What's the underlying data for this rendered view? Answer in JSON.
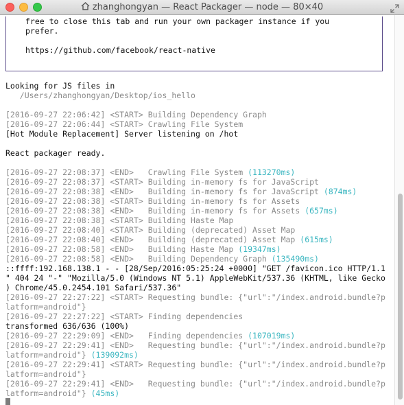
{
  "window": {
    "title": "zhanghongyan — React Packager — node — 80×40"
  },
  "banner": [
    "free to close this tab and run your own packager instance if you",
    "prefer.",
    "",
    "https://github.com/facebook/react-native",
    ""
  ],
  "lines": [
    {
      "segments": [
        {
          "text": "",
          "style": "normal"
        }
      ]
    },
    {
      "segments": [
        {
          "text": "Looking for JS files in",
          "style": "normal"
        }
      ]
    },
    {
      "segments": [
        {
          "text": "   /Users/zhanghongyan/Desktop/ios_hello",
          "style": "dim"
        }
      ]
    },
    {
      "segments": [
        {
          "text": "",
          "style": "normal"
        }
      ]
    },
    {
      "segments": [
        {
          "text": "[2016-09-27 22:06:42] <START> Building Dependency Graph",
          "style": "dim"
        }
      ]
    },
    {
      "segments": [
        {
          "text": "[2016-09-27 22:06:44] <START> Crawling File System",
          "style": "dim"
        }
      ]
    },
    {
      "segments": [
        {
          "text": "[Hot Module Replacement] Server listening on /hot",
          "style": "normal"
        }
      ]
    },
    {
      "segments": [
        {
          "text": "",
          "style": "normal"
        }
      ]
    },
    {
      "segments": [
        {
          "text": "React packager ready.",
          "style": "normal"
        }
      ]
    },
    {
      "segments": [
        {
          "text": "",
          "style": "normal"
        }
      ]
    },
    {
      "segments": [
        {
          "text": "[2016-09-27 22:08:37] <END>   Crawling File System ",
          "style": "dim"
        },
        {
          "text": "(113270ms)",
          "style": "time"
        }
      ]
    },
    {
      "segments": [
        {
          "text": "[2016-09-27 22:08:37] <START> Building in-memory fs for JavaScript",
          "style": "dim"
        }
      ]
    },
    {
      "segments": [
        {
          "text": "[2016-09-27 22:08:38] <END>   Building in-memory fs for JavaScript ",
          "style": "dim"
        },
        {
          "text": "(874ms)",
          "style": "time"
        }
      ]
    },
    {
      "segments": [
        {
          "text": "[2016-09-27 22:08:38] <START> Building in-memory fs for Assets",
          "style": "dim"
        }
      ]
    },
    {
      "segments": [
        {
          "text": "[2016-09-27 22:08:38] <END>   Building in-memory fs for Assets ",
          "style": "dim"
        },
        {
          "text": "(657ms)",
          "style": "time"
        }
      ]
    },
    {
      "segments": [
        {
          "text": "[2016-09-27 22:08:38] <START> Building Haste Map",
          "style": "dim"
        }
      ]
    },
    {
      "segments": [
        {
          "text": "[2016-09-27 22:08:40] <START> Building (deprecated) Asset Map",
          "style": "dim"
        }
      ]
    },
    {
      "segments": [
        {
          "text": "[2016-09-27 22:08:40] <END>   Building (deprecated) Asset Map ",
          "style": "dim"
        },
        {
          "text": "(615ms)",
          "style": "time"
        }
      ]
    },
    {
      "segments": [
        {
          "text": "[2016-09-27 22:08:58] <END>   Building Haste Map ",
          "style": "dim"
        },
        {
          "text": "(19347ms)",
          "style": "time"
        }
      ]
    },
    {
      "segments": [
        {
          "text": "[2016-09-27 22:08:58] <END>   Building Dependency Graph ",
          "style": "dim"
        },
        {
          "text": "(135490ms)",
          "style": "time"
        }
      ]
    },
    {
      "segments": [
        {
          "text": "::ffff:192.168.138.1 - - [28/Sep/2016:05:25:24 +0000] \"GET /favicon.ico HTTP/1.1",
          "style": "normal"
        }
      ]
    },
    {
      "segments": [
        {
          "text": "\" 404 24 \"-\" \"Mozilla/5.0 (Windows NT 5.1) AppleWebKit/537.36 (KHTML, like Gecko",
          "style": "normal"
        }
      ]
    },
    {
      "segments": [
        {
          "text": ") Chrome/45.0.2454.101 Safari/537.36\"",
          "style": "normal"
        }
      ]
    },
    {
      "segments": [
        {
          "text": "[2016-09-27 22:27:22] <START> Requesting bundle: {\"url\":\"/index.android.bundle?p",
          "style": "dim"
        }
      ]
    },
    {
      "segments": [
        {
          "text": "latform=android\"}",
          "style": "dim"
        }
      ]
    },
    {
      "segments": [
        {
          "text": "[2016-09-27 22:27:22] <START> Finding dependencies",
          "style": "dim"
        }
      ]
    },
    {
      "segments": [
        {
          "text": "transformed 636/636 (100%)",
          "style": "normal"
        }
      ]
    },
    {
      "segments": [
        {
          "text": "[2016-09-27 22:29:09] <END>   Finding dependencies ",
          "style": "dim"
        },
        {
          "text": "(107019ms)",
          "style": "time"
        }
      ]
    },
    {
      "segments": [
        {
          "text": "[2016-09-27 22:29:41] <END>   Requesting bundle: {\"url\":\"/index.android.bundle?p",
          "style": "dim"
        }
      ]
    },
    {
      "segments": [
        {
          "text": "latform=android\"} ",
          "style": "dim"
        },
        {
          "text": "(139092ms)",
          "style": "time"
        }
      ]
    },
    {
      "segments": [
        {
          "text": "[2016-09-27 22:29:41] <START> Requesting bundle: {\"url\":\"/index.android.bundle?p",
          "style": "dim"
        }
      ]
    },
    {
      "segments": [
        {
          "text": "latform=android\"}",
          "style": "dim"
        }
      ]
    },
    {
      "segments": [
        {
          "text": "[2016-09-27 22:29:41] <END>   Requesting bundle: {\"url\":\"/index.android.bundle?p",
          "style": "dim"
        }
      ]
    },
    {
      "segments": [
        {
          "text": "latform=android\"} ",
          "style": "dim"
        },
        {
          "text": "(45ms)",
          "style": "time"
        }
      ]
    }
  ],
  "colors": {
    "dim_text": "#8a8a8a",
    "timing_text": "#3ab6c0",
    "box_border": "#5a4b8a"
  },
  "icons": {
    "title_icon": "home-icon",
    "fullscreen": "fullscreen-arrows-icon"
  }
}
